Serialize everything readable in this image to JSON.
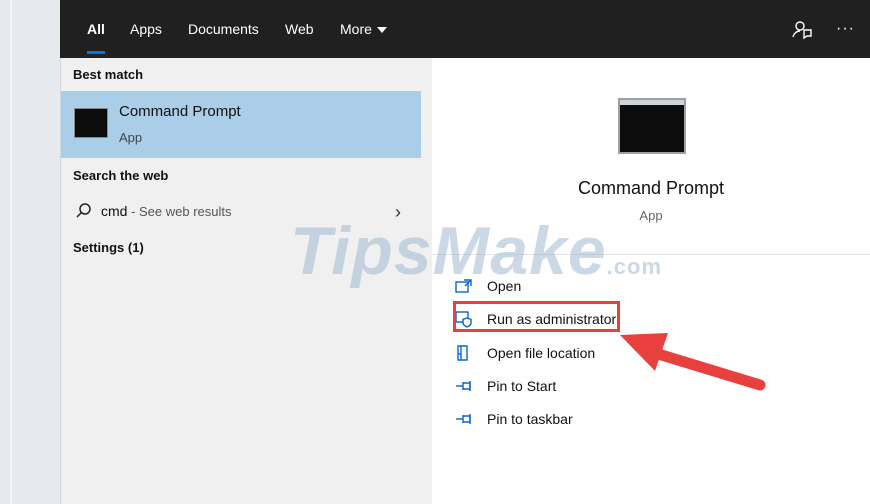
{
  "tabs": [
    {
      "label": "All",
      "active": true
    },
    {
      "label": "Apps"
    },
    {
      "label": "Documents"
    },
    {
      "label": "Web"
    },
    {
      "label": "More"
    }
  ],
  "topbar_icons": [
    "feedback-icon",
    "more-options-icon"
  ],
  "left": {
    "best_match_heading": "Best match",
    "best_match": {
      "title": "Command Prompt",
      "subtitle": "App"
    },
    "search_web_heading": "Search the web",
    "web_result": {
      "query": "cmd",
      "hint": " - See web results"
    },
    "settings_heading": "Settings (1)"
  },
  "detail": {
    "title": "Command Prompt",
    "subtitle": "App",
    "actions": [
      {
        "label": "Open",
        "icon": "open-icon"
      },
      {
        "label": "Run as administrator",
        "icon": "shield-icon"
      },
      {
        "label": "Open file location",
        "icon": "file-location-icon"
      },
      {
        "label": "Pin to Start",
        "icon": "pin-icon"
      },
      {
        "label": "Pin to taskbar",
        "icon": "pin-icon"
      }
    ]
  },
  "watermark": {
    "text": "TipsMake",
    "suffix": ".com"
  },
  "colors": {
    "accent": "#0078d7",
    "selection": "#aacde8",
    "highlight": "#e8403c",
    "topbar": "#202020"
  }
}
